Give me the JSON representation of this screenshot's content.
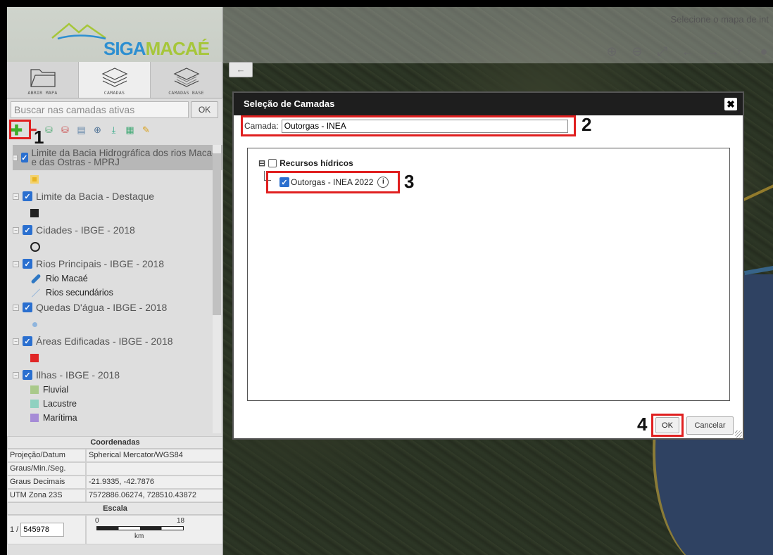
{
  "top_bar": {
    "hint": "Selecione o mapa de int",
    "tools": [
      {
        "icon": "zoom-in-icon",
        "glyph": "⊕"
      },
      {
        "icon": "zoom-out-icon",
        "glyph": "⊖"
      },
      {
        "icon": "zoom-extent-icon",
        "glyph": "⤢"
      },
      {
        "icon": "arrow-left-icon",
        "glyph": "←"
      },
      {
        "icon": "arrow-right-icon",
        "glyph": "→"
      },
      {
        "icon": "identify-icon",
        "glyph": "☞"
      },
      {
        "icon": "info-icon",
        "glyph": "●"
      }
    ],
    "back_glyph": "←"
  },
  "logo": {
    "part1": "SIGA",
    "part2": "MACAÉ"
  },
  "tabs": [
    {
      "label": "ABRIR MAPA",
      "icon": "folder-icon"
    },
    {
      "label": "CAMADAS",
      "icon": "layers-icon"
    },
    {
      "label": "CAMADAS BASE",
      "icon": "base-layers-icon"
    }
  ],
  "search": {
    "placeholder": "Buscar nas camadas ativas",
    "ok_label": "OK"
  },
  "toolbar": {
    "add_icon": "add-layer-icon",
    "icons": [
      "remove-layer-icon",
      "load-icon",
      "save-icon",
      "document-icon",
      "zoom-layer-icon",
      "download-icon",
      "table-icon",
      "edit-icon"
    ]
  },
  "callouts": {
    "c1": "1",
    "c2": "2",
    "c3": "3",
    "c4": "4"
  },
  "layers": [
    {
      "name": "Limite da Bacia Hidrográfica dos rios Macaé e das Ostras - MPRJ",
      "selected": true,
      "legend": [
        {
          "symbol": "square-outline",
          "color": "#e8b422",
          "label": ""
        }
      ]
    },
    {
      "name": "Limite da Bacia - Destaque",
      "legend": [
        {
          "symbol": "square",
          "color": "#222222",
          "label": ""
        }
      ]
    },
    {
      "name": "Cidades - IBGE - 2018",
      "legend": [
        {
          "symbol": "circle",
          "color": "#222222",
          "label": ""
        }
      ]
    },
    {
      "name": "Rios Principais - IBGE - 2018",
      "legend": [
        {
          "symbol": "thick-line",
          "color": "#2f78c4",
          "label": "Rio Macaé"
        },
        {
          "symbol": "thin-line",
          "color": "#9ab8d8",
          "label": "Rios secundários"
        }
      ]
    },
    {
      "name": "Quedas D'água - IBGE - 2018",
      "legend": [
        {
          "symbol": "dot",
          "color": "#8fb5dd",
          "label": ""
        }
      ]
    },
    {
      "name": "Áreas Edificadas - IBGE - 2018",
      "legend": [
        {
          "symbol": "square",
          "color": "#e02626",
          "label": ""
        }
      ]
    },
    {
      "name": "Ilhas - IBGE - 2018",
      "legend": [
        {
          "symbol": "square",
          "color": "#a9c98a",
          "label": "Fluvial"
        },
        {
          "symbol": "square",
          "color": "#8fd1c0",
          "label": "Lacustre"
        },
        {
          "symbol": "square",
          "color": "#a58bd6",
          "label": "Marítima"
        }
      ]
    }
  ],
  "coords": {
    "title": "Coordenadas",
    "rows": [
      {
        "k": "Projeção/Datum",
        "v": "Spherical Mercator/WGS84"
      },
      {
        "k": "Graus/Min./Seg.",
        "v": ""
      },
      {
        "k": "Graus Decimais",
        "v": "-21.9335, -42.7876"
      },
      {
        "k": "UTM Zona 23S",
        "v": "7572886.06274, 728510.43872"
      }
    ],
    "scale_title": "Escala",
    "scale_prefix": "1 /",
    "scale_value": "545978",
    "bar_min": "0",
    "bar_max": "18",
    "bar_unit": "km"
  },
  "modal": {
    "title": "Seleção de Camadas",
    "close_glyph": "✖",
    "camada_label": "Camada:",
    "camada_value": "Outorgas - INEA",
    "tree_root": "Recursos hídricos",
    "tree_child": "Outorgas - INEA 2022",
    "ok_label": "OK",
    "cancel_label": "Cancelar"
  }
}
